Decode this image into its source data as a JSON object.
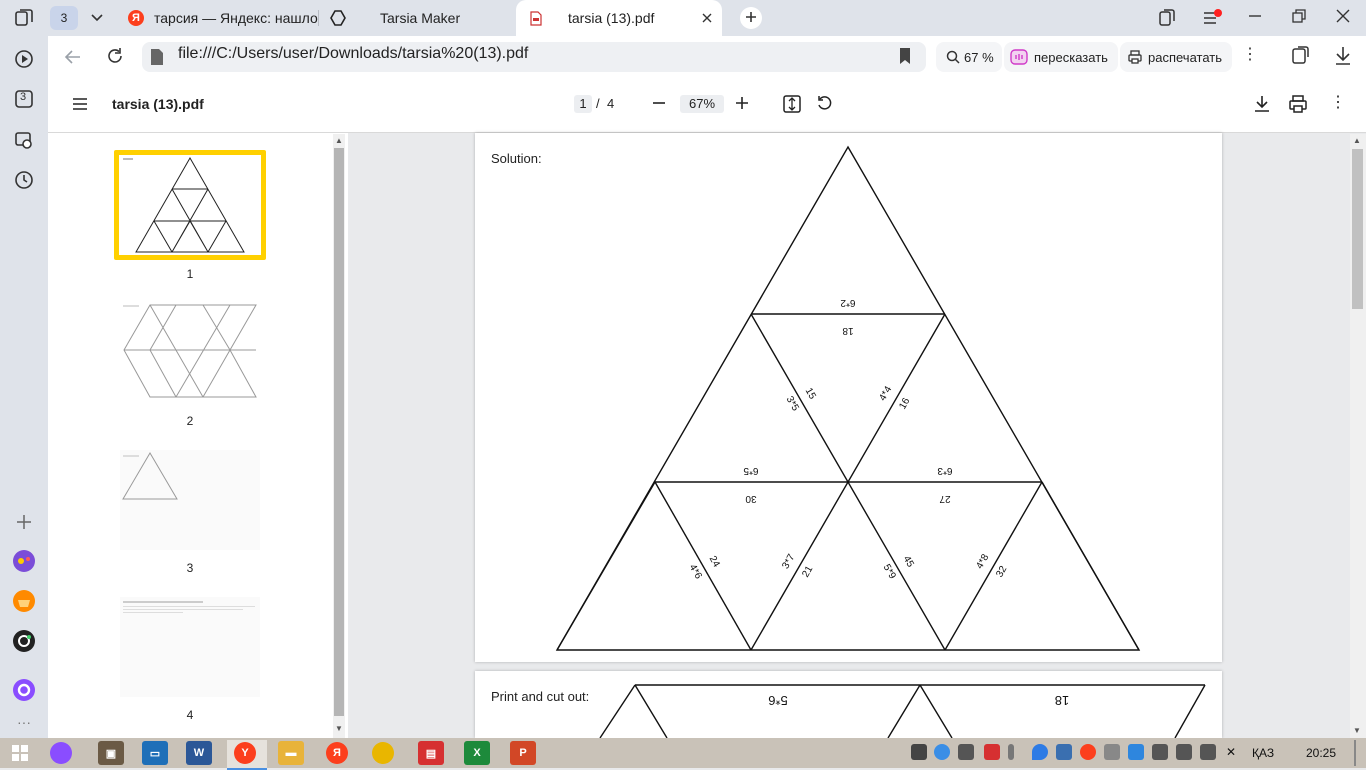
{
  "browser": {
    "tab_count_badge": "3",
    "tabs": [
      {
        "label": "тарсия — Яндекс: нашлос"
      },
      {
        "label": "Tarsia Maker"
      },
      {
        "label": "tarsia (13).pdf"
      }
    ],
    "new_tab_icon": "plus-icon",
    "address": "file:///C:/Users/user/Downloads/tarsia%20(13).pdf",
    "zoom_pill": "67 %",
    "summarize_label": "пересказать",
    "print_label": "распечатать",
    "sidebar_badge": "3"
  },
  "pdf": {
    "title": "tarsia (13).pdf",
    "page_current": "1",
    "page_sep": "/",
    "page_total": "4",
    "zoom": "67%",
    "thumbnails": [
      {
        "num": "1"
      },
      {
        "num": "2"
      },
      {
        "num": "3"
      },
      {
        "num": "4"
      }
    ],
    "page1": {
      "heading": "Solution:",
      "labels": [
        {
          "text": "6*2"
        },
        {
          "text": "18"
        },
        {
          "text": "15"
        },
        {
          "text": "3*5"
        },
        {
          "text": "4*4"
        },
        {
          "text": "16"
        },
        {
          "text": "6*5"
        },
        {
          "text": "30"
        },
        {
          "text": "6*3"
        },
        {
          "text": "27"
        },
        {
          "text": "24"
        },
        {
          "text": "4*6"
        },
        {
          "text": "3*7"
        },
        {
          "text": "21"
        },
        {
          "text": "45"
        },
        {
          "text": "5*9"
        },
        {
          "text": "4*8"
        },
        {
          "text": "32"
        }
      ]
    },
    "page2": {
      "heading": "Print and cut out:",
      "labels": [
        {
          "text": "5*6"
        },
        {
          "text": "18"
        }
      ]
    }
  },
  "taskbar": {
    "lang": "ҚАЗ",
    "time": "20:25"
  }
}
